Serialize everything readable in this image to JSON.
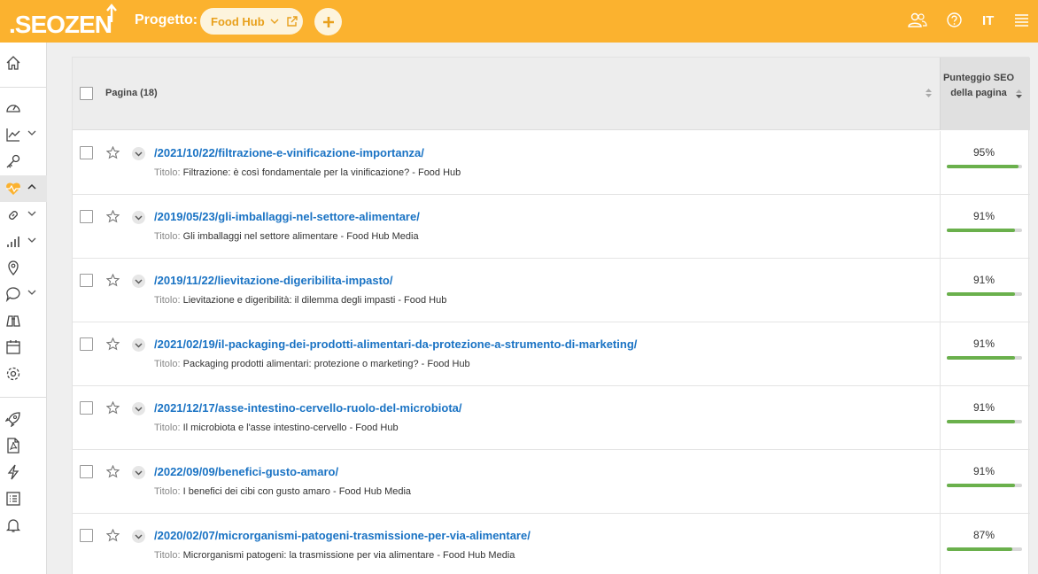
{
  "header": {
    "logo_text": ".SEOZEN",
    "project_label": "Progetto:",
    "project_name": "Food Hub",
    "language": "IT",
    "accent_color": "#fbb22f",
    "icons": [
      "users-icon",
      "help-icon",
      "menu-icon"
    ]
  },
  "sidebar": {
    "items": [
      {
        "icon": "home-icon",
        "expandable": false
      },
      {
        "icon": "dashboard-gauge-icon",
        "expandable": false
      },
      {
        "icon": "trend-chart-icon",
        "expandable": true
      },
      {
        "icon": "key-icon",
        "expandable": false
      },
      {
        "icon": "heart-pulse-icon",
        "expandable": true,
        "active": true
      },
      {
        "icon": "link-icon",
        "expandable": true
      },
      {
        "icon": "bar-chart-icon",
        "expandable": true
      },
      {
        "icon": "location-pin-icon",
        "expandable": false
      },
      {
        "icon": "chat-bubble-icon",
        "expandable": true
      },
      {
        "icon": "binoculars-icon",
        "expandable": false
      },
      {
        "icon": "calendar-icon",
        "expandable": false
      },
      {
        "icon": "gear-icon",
        "expandable": false
      },
      {
        "icon": "rocket-icon",
        "expandable": false
      },
      {
        "icon": "pdf-file-icon",
        "expandable": false
      },
      {
        "icon": "lightning-icon",
        "expandable": false
      },
      {
        "icon": "checklist-icon",
        "expandable": false
      },
      {
        "icon": "bell-icon",
        "expandable": false
      }
    ]
  },
  "table": {
    "col_page": "Pagina (18)",
    "col_score": "Punteggio SEO della pagina",
    "title_prefix": "Titolo:",
    "rows": [
      {
        "url": "/2021/10/22/filtrazione-e-vinificazione-importanza/",
        "title": "Filtrazione: è così fondamentale per la vinificazione? - Food Hub",
        "score": "95%",
        "score_value": 95
      },
      {
        "url": "/2019/05/23/gli-imballaggi-nel-settore-alimentare/",
        "title": "Gli imballaggi nel settore alimentare - Food Hub Media",
        "score": "91%",
        "score_value": 91
      },
      {
        "url": "/2019/11/22/lievitazione-digeribilita-impasto/",
        "title": "Lievitazione e digeribilità: il dilemma degli impasti - Food Hub",
        "score": "91%",
        "score_value": 91
      },
      {
        "url": "/2021/02/19/il-packaging-dei-prodotti-alimentari-da-protezione-a-strumento-di-marketing/",
        "title": "Packaging prodotti alimentari: protezione o marketing? - Food Hub",
        "score": "91%",
        "score_value": 91
      },
      {
        "url": "/2021/12/17/asse-intestino-cervello-ruolo-del-microbiota/",
        "title": "Il microbiota e l'asse intestino-cervello - Food Hub",
        "score": "91%",
        "score_value": 91
      },
      {
        "url": "/2022/09/09/benefici-gusto-amaro/",
        "title": "I benefici dei cibi con gusto amaro - Food Hub Media",
        "score": "91%",
        "score_value": 91
      },
      {
        "url": "/2020/02/07/microrganismi-patogeni-trasmissione-per-via-alimentare/",
        "title": "Microrganismi patogeni: la trasmissione per via alimentare - Food Hub Media",
        "score": "87%",
        "score_value": 87
      }
    ]
  }
}
